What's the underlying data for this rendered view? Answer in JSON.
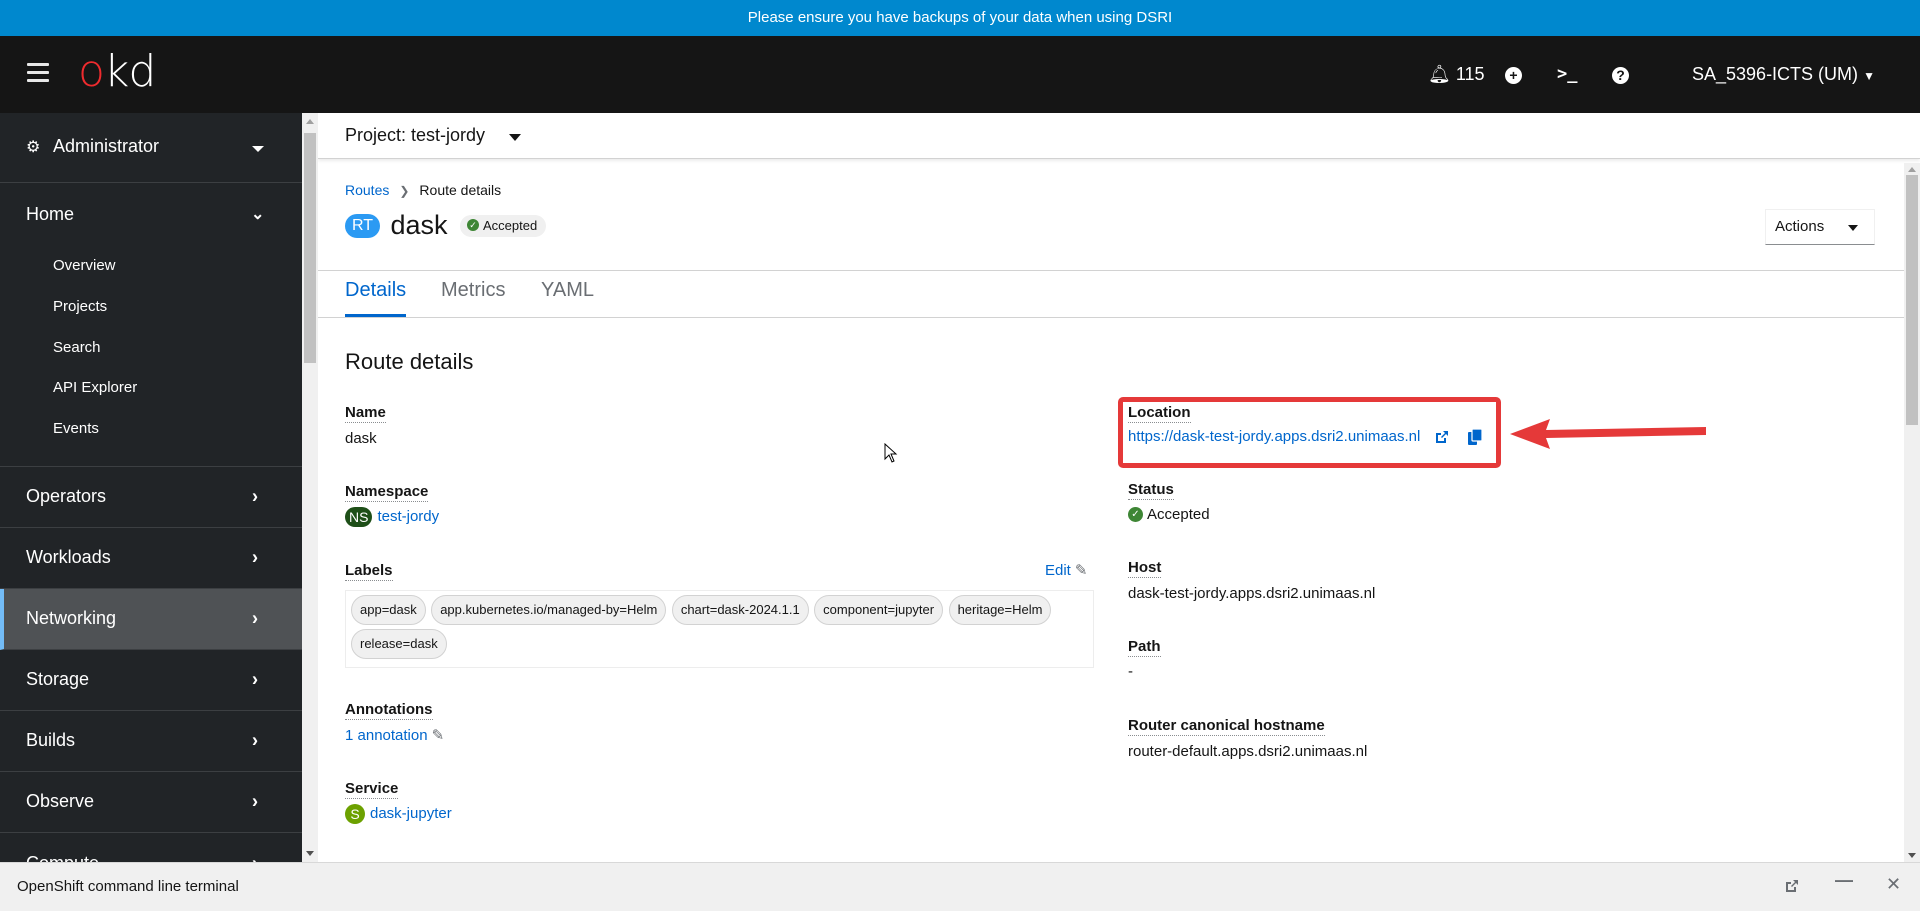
{
  "banner": {
    "text": "Please ensure you have backups of your data when using DSRI",
    "color": "#0088ce"
  },
  "header": {
    "logo": {
      "o": "o",
      "kd": "kd"
    },
    "notifications_count": "115",
    "user_label": "SA_5396-ICTS (UM)",
    "icons": [
      "menu-icon",
      "bell-icon",
      "plus-circle-icon",
      "terminal-icon",
      "help-icon",
      "caret-down-icon"
    ]
  },
  "sidebar": {
    "perspective": "Administrator",
    "home": {
      "label": "Home",
      "items": [
        "Overview",
        "Projects",
        "Search",
        "API Explorer",
        "Events"
      ]
    },
    "sections": [
      {
        "label": "Operators",
        "active": false
      },
      {
        "label": "Workloads",
        "active": false
      },
      {
        "label": "Networking",
        "active": true
      },
      {
        "label": "Storage",
        "active": false
      },
      {
        "label": "Builds",
        "active": false
      },
      {
        "label": "Observe",
        "active": false
      },
      {
        "label": "Compute",
        "active": false
      }
    ],
    "active_color": "#73bcf7"
  },
  "project_bar": {
    "label": "Project: test-jordy"
  },
  "breadcrumb": {
    "parent": "Routes",
    "current": "Route details"
  },
  "resource": {
    "badge": "RT",
    "name": "dask",
    "status": "Accepted",
    "actions_label": "Actions"
  },
  "tabs": [
    {
      "label": "Details",
      "active": true
    },
    {
      "label": "Metrics",
      "active": false
    },
    {
      "label": "YAML",
      "active": false
    }
  ],
  "details": {
    "section_title": "Route details",
    "left": {
      "name": {
        "label": "Name",
        "value": "dask"
      },
      "namespace": {
        "label": "Namespace",
        "badge": "NS",
        "value": "test-jordy"
      },
      "labels": {
        "label": "Labels",
        "edit_label": "Edit",
        "chips": [
          "app=dask",
          "app.kubernetes.io/managed-by=Helm",
          "chart=dask-2024.1.1",
          "component=jupyter",
          "heritage=Helm",
          "release=dask"
        ]
      },
      "annotations": {
        "label": "Annotations",
        "value": "1 annotation"
      },
      "service": {
        "label": "Service",
        "badge": "S",
        "value": "dask-jupyter"
      }
    },
    "right": {
      "location": {
        "label": "Location",
        "value": "https://dask-test-jordy.apps.dsri2.unimaas.nl"
      },
      "status": {
        "label": "Status",
        "value": "Accepted"
      },
      "host": {
        "label": "Host",
        "value": "dask-test-jordy.apps.dsri2.unimaas.nl"
      },
      "path": {
        "label": "Path",
        "value": "-"
      },
      "router_hostname": {
        "label": "Router canonical hostname",
        "value": "router-default.apps.dsri2.unimaas.nl"
      }
    }
  },
  "annotation_overlay": {
    "highlight_color": "#e53939"
  },
  "terminal": {
    "label": "OpenShift command line terminal"
  }
}
